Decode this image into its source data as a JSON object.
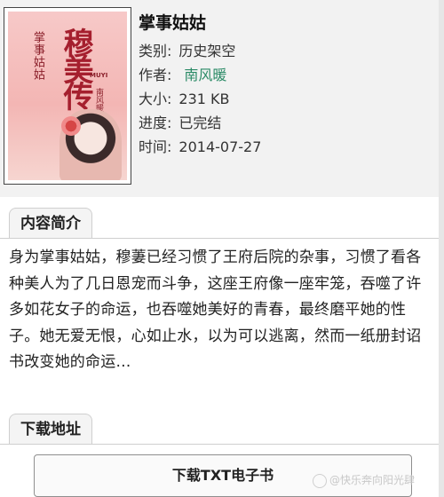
{
  "book": {
    "title": "掌事姑姑",
    "category_label": "类别:",
    "category_value": "历史架空",
    "author_label": "作者:",
    "author_value": "南风暖",
    "size_label": "大小:",
    "size_value": "231 KB",
    "status_label": "进度:",
    "status_value": "已完结",
    "time_label": "时间:",
    "time_value": "2014-07-27",
    "cover": {
      "subtitle": "掌事姑姑",
      "main": "穆美传",
      "brand": "MUYI",
      "author": "南风暖"
    }
  },
  "intro": {
    "tab_label": "内容简介",
    "text": "身为掌事姑姑，穆萋已经习惯了王府后院的杂事，习惯了看各种美人为了几日恩宠而斗争，这座王府像一座牢笼，吞噬了许多如花女子的命运，也吞噬她美好的青春，最终磨平她的性子。她无爱无恨，心如止水，以为可以逃离，然而一纸册封诏书改变她的命运…"
  },
  "download": {
    "tab_label": "下载地址",
    "button_label": "下载TXT电子书"
  },
  "watermark": "@快乐奔向阳光肆"
}
